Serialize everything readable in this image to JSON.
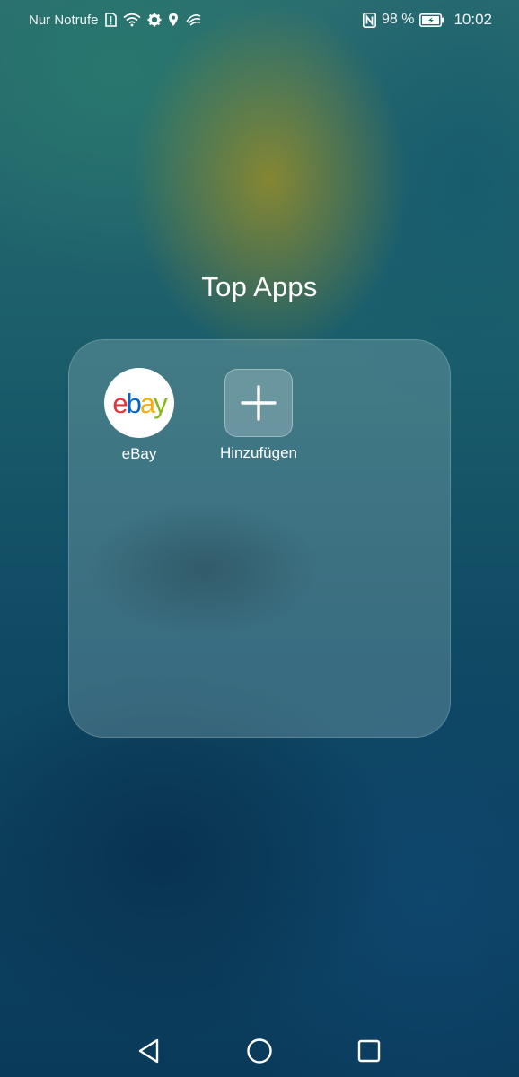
{
  "status_bar": {
    "carrier": "Nur Notrufe",
    "icons_left": [
      "sim-alert-icon",
      "wifi-icon",
      "settings-gear-icon",
      "location-pin-icon",
      "swiftkey-icon"
    ],
    "icons_right": [
      "nfc-icon",
      "battery-charging-icon"
    ],
    "battery": "98 %",
    "time": "10:02"
  },
  "folder": {
    "title": "Top Apps",
    "apps": [
      {
        "label": "eBay",
        "icon": "ebay-logo-icon"
      },
      {
        "label": "Hinzufügen",
        "icon": "plus-icon"
      }
    ]
  },
  "ebay_logo": {
    "e": "e",
    "b": "b",
    "a": "a",
    "y": "y"
  },
  "nav_bar": {
    "buttons": [
      "back-triangle-icon",
      "home-circle-icon",
      "recent-square-icon"
    ]
  },
  "colors": {
    "ebay_red": "#e53238",
    "ebay_blue": "#0064d2",
    "ebay_yellow": "#f5af02",
    "ebay_green": "#86b817"
  }
}
